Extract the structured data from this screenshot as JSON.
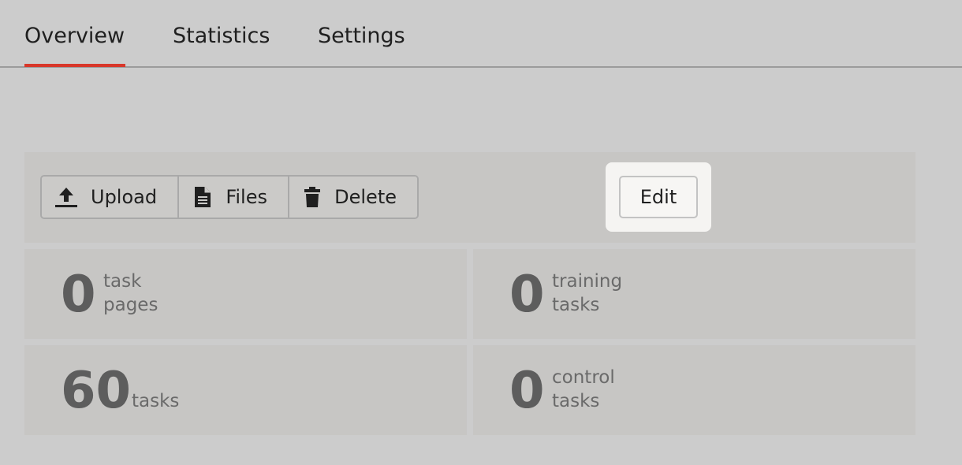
{
  "tabs": {
    "overview": "Overview",
    "statistics": "Statistics",
    "settings": "Settings"
  },
  "toolbar": {
    "upload_label": "Upload",
    "files_label": "Files",
    "delete_label": "Delete",
    "edit_label": "Edit"
  },
  "stats": {
    "task_pages": {
      "value": "0",
      "label_line1": "task",
      "label_line2": "pages"
    },
    "training_tasks": {
      "value": "0",
      "label_line1": "training",
      "label_line2": "tasks"
    },
    "tasks": {
      "value": "60",
      "label": "tasks"
    },
    "control_tasks": {
      "value": "0",
      "label_line1": "control",
      "label_line2": "tasks"
    }
  },
  "colors": {
    "background": "#cccccc",
    "panel": "#c7c6c4",
    "active_tab_accent": "#d8372a",
    "edit_highlight": "#f5f4f2"
  },
  "icons": {
    "upload": "upload-icon",
    "files": "file-icon",
    "delete": "trash-icon"
  }
}
